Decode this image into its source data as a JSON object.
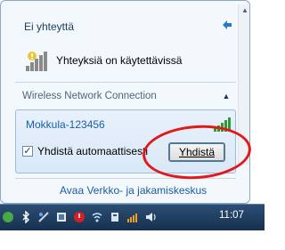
{
  "flyout": {
    "title": "Ei yhteyttä",
    "connections_text": "Yhteyksiä on käytettävissä",
    "section_header": "Wireless Network Connection",
    "network": {
      "name": "Mokkula-123456",
      "auto_connect_label": "Yhdistä automaattisesti",
      "auto_connect_checked": true,
      "connect_button": "Yhdistä"
    },
    "footer_link": "Avaa Verkko- ja jakamiskeskus"
  },
  "taskbar": {
    "clock": "11:07",
    "tray_icons": [
      "app-icon",
      "bluetooth-icon",
      "network-tray-icon",
      "flag-icon",
      "power-icon",
      "wifi-icon",
      "device-icon",
      "signal-icon",
      "volume-icon"
    ]
  },
  "colors": {
    "annotation": "#e11919",
    "link": "#1c5ca0",
    "taskbar": "#1d3a5c"
  }
}
